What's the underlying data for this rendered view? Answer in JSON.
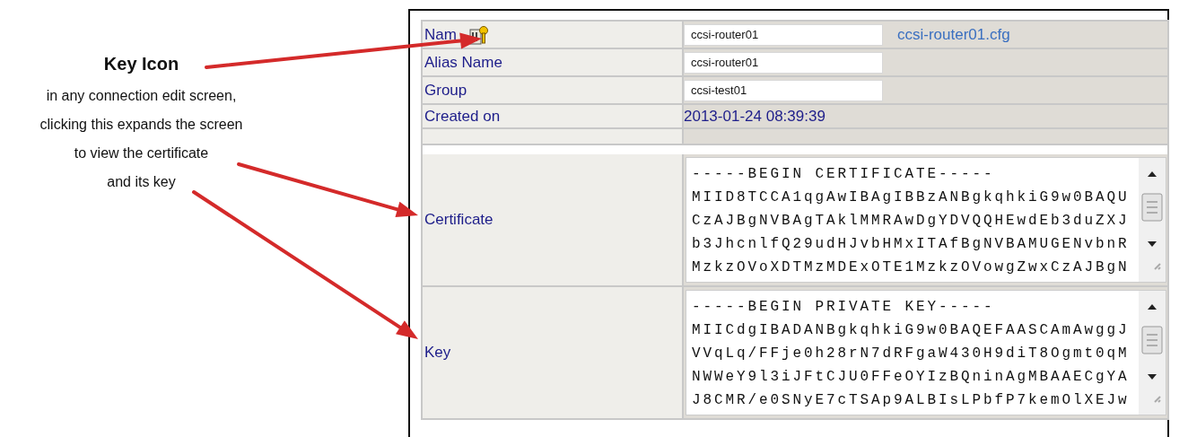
{
  "annotation": {
    "title": "Key Icon",
    "lines": [
      "in any connection edit screen,",
      "clicking this expands the screen",
      "to view the certificate",
      "and its key"
    ]
  },
  "form": {
    "rows": [
      {
        "kind": "input",
        "label": "Nam",
        "key_icon": true,
        "value": "ccsi-router01",
        "link": "ccsi-router01.cfg"
      },
      {
        "kind": "input",
        "label": "Alias Name",
        "value": "ccsi-router01"
      },
      {
        "kind": "input",
        "label": "Group",
        "value": "ccsi-test01"
      },
      {
        "kind": "text",
        "label": "Created on",
        "value": "2013-01-24 08:39:39"
      },
      {
        "kind": "textarea",
        "label": "Certificate",
        "lines": [
          "-----BEGIN CERTIFICATE-----",
          "MIID8TCCA1qgAwIBAgIBBzANBgkqhkiG9w0BAQU",
          "CzAJBgNVBAgTAklMMRAwDgYDVQQHEwdEb3duZXJ",
          "b3JhcnlfQ29udHJvbHMxITAfBgNVBAMUGENvbnR",
          "MzkzOVoXDTMzMDExOTE1MzkzOVowgZwxCzAJBgN"
        ]
      },
      {
        "kind": "textarea",
        "label": "Key",
        "lines": [
          "-----BEGIN PRIVATE KEY-----",
          "MIICdgIBADANBgkqhkiG9w0BAQEFAASCAmAwggJ",
          "VVqLq/FFje0h28rN7dRFgaW430H9diT8Ogmt0qM",
          "NWWeY9l3iJFtCJU0FFeOYIzBQninAgMBAAECgYA",
          "J8CMR/e0SNyE7cTSAp9ALBIsLPbfP7kemOlXEJw"
        ]
      }
    ]
  }
}
